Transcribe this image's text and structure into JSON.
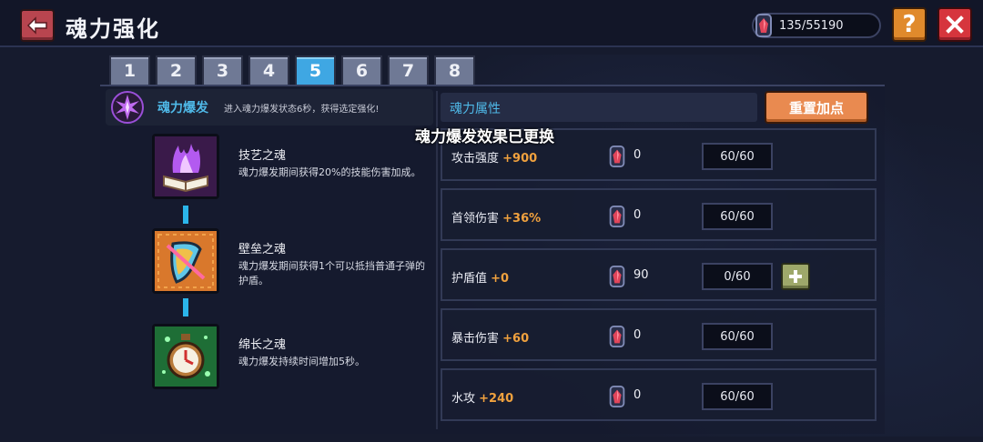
{
  "header": {
    "title": "魂力强化",
    "currency_value": "135/55190",
    "help_label": "?"
  },
  "tabs": [
    {
      "label": "1"
    },
    {
      "label": "2"
    },
    {
      "label": "3"
    },
    {
      "label": "4"
    },
    {
      "label": "5"
    },
    {
      "label": "6"
    },
    {
      "label": "7"
    },
    {
      "label": "8"
    }
  ],
  "active_tab": "5",
  "burst": {
    "title": "魂力爆发",
    "description": "进入魂力爆发状态6秒，获得选定强化!"
  },
  "souls": [
    {
      "name": "技艺之魂",
      "description": "魂力爆发期间获得20%的技能伤害加成。",
      "icon": "purple-flame-book-icon"
    },
    {
      "name": "壁垒之魂",
      "description": "魂力爆发期间获得1个可以抵挡普通子弹的护盾。",
      "icon": "shield-icon"
    },
    {
      "name": "绵长之魂",
      "description": "魂力爆发持续时间增加5秒。",
      "icon": "stopwatch-icon"
    }
  ],
  "attributes_panel": {
    "title": "魂力属性",
    "reset_label": "重置加点",
    "notice": "魂力爆发效果已更换"
  },
  "attributes": [
    {
      "name": "攻击强度",
      "bonus": "+900",
      "points": "0",
      "level": "60/60",
      "has_plus": false
    },
    {
      "name": "首领伤害",
      "bonus": "+36%",
      "points": "0",
      "level": "60/60",
      "has_plus": false
    },
    {
      "name": "护盾值",
      "bonus": "+0",
      "points": "90",
      "level": "0/60",
      "has_plus": true
    },
    {
      "name": "暴击伤害",
      "bonus": "+60",
      "points": "0",
      "level": "60/60",
      "has_plus": false
    },
    {
      "name": "水攻",
      "bonus": "+240",
      "points": "0",
      "level": "60/60",
      "has_plus": false
    }
  ],
  "colors": {
    "accent_blue": "#4fb9e8",
    "bonus_orange": "#f0a13e",
    "active_tab": "#3fa7e3"
  }
}
